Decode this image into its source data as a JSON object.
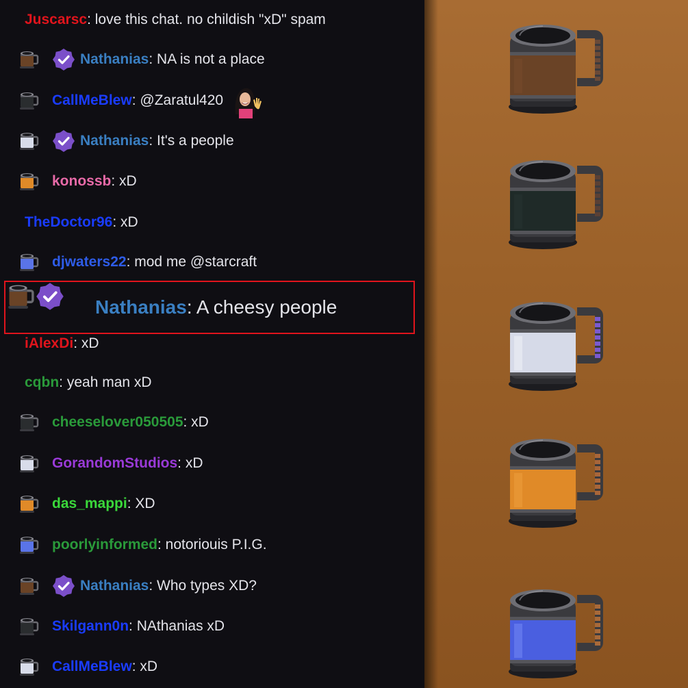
{
  "chat": {
    "messages": [
      {
        "user": "Juscarsc",
        "color": "#e0141c",
        "text": ": love this chat. no childish \"xD\" spam",
        "badge": "none",
        "verified": false
      },
      {
        "user": "Nathanias",
        "color": "#3a7fc2",
        "text": ": NA is not a place",
        "badge": "wood",
        "verified": true
      },
      {
        "user": "CallMeBlew",
        "color": "#1a3cff",
        "text": ": @Zaratul420",
        "badge": "dark",
        "verified": false,
        "emote": "waving-woman-emote"
      },
      {
        "user": "Nathanias",
        "color": "#3a7fc2",
        "text": ": It's a people",
        "badge": "silver",
        "verified": true
      },
      {
        "user": "konossb",
        "color": "#e86aa8",
        "text": ": xD",
        "badge": "gold",
        "verified": false
      },
      {
        "user": "TheDoctor96",
        "color": "#1a3cff",
        "text": ": xD",
        "badge": "none",
        "verified": false
      },
      {
        "user": "djwaters22",
        "color": "#2e5ce8",
        "text": ": mod me @starcraft",
        "badge": "blue",
        "verified": false
      },
      {
        "user": "iAlexDi",
        "color": "#e0141c",
        "text": ": xD",
        "badge": "none",
        "verified": false
      },
      {
        "user": "cqbn",
        "color": "#2a9a3a",
        "text": ": yeah man xD",
        "badge": "none",
        "verified": false
      },
      {
        "user": "cheeselover050505",
        "color": "#2a9a3a",
        "text": ": xD",
        "badge": "dark",
        "verified": false
      },
      {
        "user": "GorandomStudios",
        "color": "#9a3ad8",
        "text": ": xD",
        "badge": "silver",
        "verified": false
      },
      {
        "user": "das_mappi",
        "color": "#3ad83a",
        "text": ": XD",
        "badge": "gold",
        "verified": false
      },
      {
        "user": "poorlyinformed",
        "color": "#2a9a3a",
        "text": ": notoriouis P.I.G.",
        "badge": "blue",
        "verified": false
      },
      {
        "user": "Nathanias",
        "color": "#3a7fc2",
        "text": ": Who types XD?",
        "badge": "wood",
        "verified": true
      },
      {
        "user": "Skilgann0n",
        "color": "#1a3cff",
        "text": ": NAthanias xD",
        "badge": "dark",
        "verified": false
      },
      {
        "user": "CallMeBlew",
        "color": "#1a3cff",
        "text": ": xD",
        "badge": "silver",
        "verified": false
      }
    ],
    "highlighted": {
      "user": "Nathanias",
      "color": "#3a7fc2",
      "text": ": A cheesy people",
      "badge": "wood",
      "verified": true
    }
  },
  "colors": {
    "highlight_border": "#e0141c",
    "verified": "#7b4fc9",
    "store_bg": "#9b6129"
  },
  "badge_palette": {
    "wood": {
      "body": "#6a4326",
      "band": "#3a2414"
    },
    "dark": {
      "body": "#2a2d2f",
      "band": "#1a1c1e"
    },
    "silver": {
      "body": "#d8dcea",
      "band": "#b8bccc"
    },
    "gold": {
      "body": "#e08a28",
      "band": "#b06418"
    },
    "blue": {
      "body": "#5a74e8",
      "band": "#3a54c8"
    }
  },
  "store": {
    "mugs": [
      {
        "name": "wood-mug",
        "body": "#6a4326",
        "stripe": "#7d5030",
        "handle": "#6a4a38"
      },
      {
        "name": "dark-mug",
        "body": "#1f2a28",
        "stripe": "#2b3a36",
        "handle": "#5a4035"
      },
      {
        "name": "silver-mug",
        "body": "#d6dae8",
        "stripe": "#ffffff",
        "handle": "#7a5ad0"
      },
      {
        "name": "gold-mug",
        "body": "#e08a28",
        "stripe": "#f4a848",
        "handle": "#a8663a"
      },
      {
        "name": "blue-mug",
        "body": "#4a5fe0",
        "stripe": "#8aa0ff",
        "handle": "#a86a3a"
      }
    ]
  }
}
